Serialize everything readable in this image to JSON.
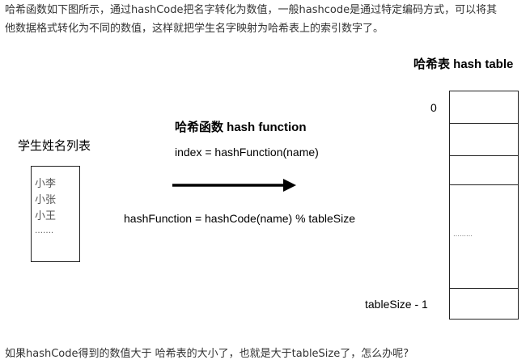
{
  "intro": {
    "line1": "哈希函数如下图所示，通过hashCode把名字转化为数值，一般hashcode是通过特定编码方式，可以将其",
    "line2": "他数据格式转化为不同的数值，这样就把学生名字映射为哈希表上的索引数字了。"
  },
  "student_list": {
    "title": "学生姓名列表",
    "names": [
      "小李",
      "小张",
      "小王",
      "……."
    ]
  },
  "hash_function": {
    "title": "哈希函数 hash function",
    "formula": "index = hashFunction(name)",
    "definition": "hashFunction = hashCode(name) % tableSize"
  },
  "hash_table": {
    "title": "哈希表 hash table",
    "first_index": "0",
    "last_index": "tableSize - 1",
    "ellipsis": "………"
  },
  "question": "如果hashCode得到的数值大于 哈希表的大小了，也就是大于tableSize了，怎么办呢?"
}
